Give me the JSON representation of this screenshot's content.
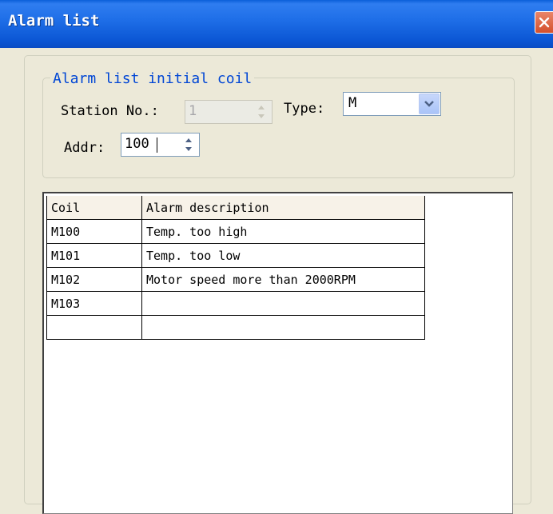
{
  "window": {
    "title": "Alarm list",
    "close_icon": "close-icon"
  },
  "group": {
    "legend": "Alarm list initial coil",
    "station_label": "Station No.:",
    "station_value": "1",
    "type_label": "Type:",
    "type_value": "M",
    "addr_label": "Addr:",
    "addr_value": "100"
  },
  "grid": {
    "headers": [
      "Coil",
      "Alarm description"
    ],
    "rows": [
      [
        "M100",
        "Temp. too high"
      ],
      [
        "M101",
        "Temp. too low"
      ],
      [
        "M102",
        "Motor speed more than 2000RPM"
      ],
      [
        "M103",
        ""
      ],
      [
        "",
        ""
      ]
    ]
  },
  "colors": {
    "titlebar": "#0a5fd8",
    "legend_text": "#0046d5",
    "dialog_bg": "#ece9d8"
  }
}
